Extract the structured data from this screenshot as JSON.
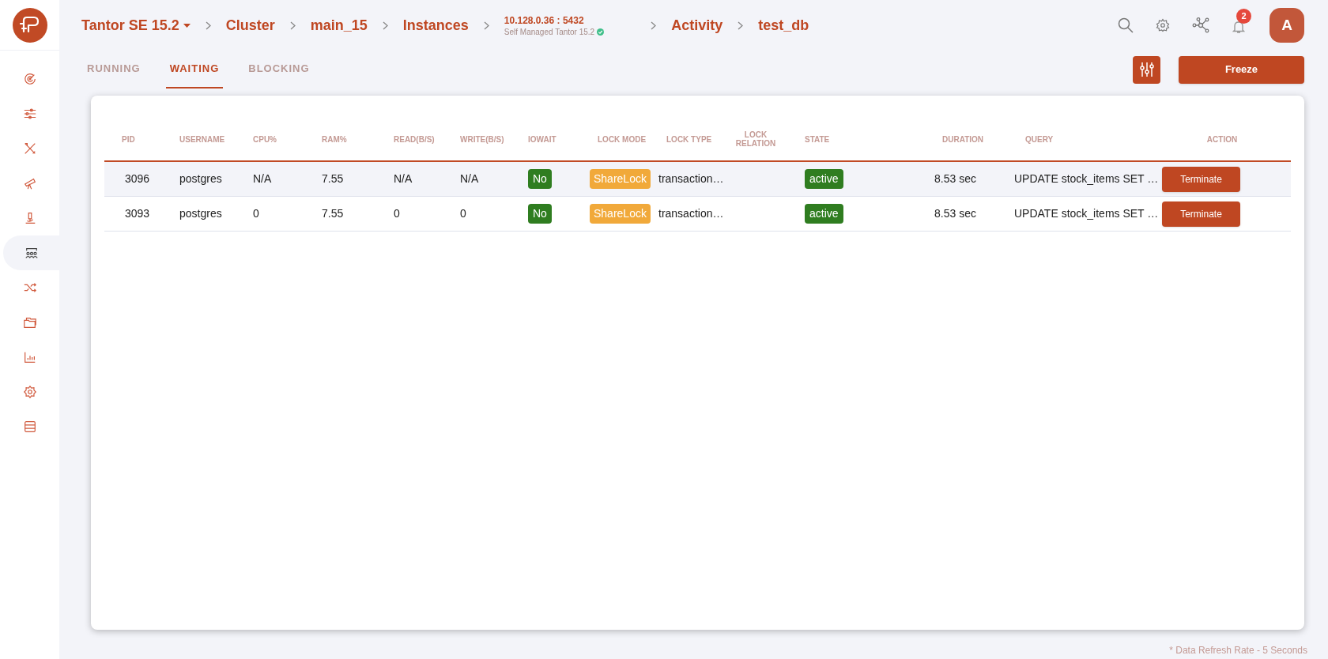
{
  "breadcrumb": [
    {
      "kind": "dropdown",
      "label": "Tantor SE 15.2"
    },
    {
      "kind": "link",
      "label": "Cluster"
    },
    {
      "kind": "link",
      "label": "main_15"
    },
    {
      "kind": "link",
      "label": "Instances"
    },
    {
      "kind": "host",
      "label": "10.128.0.36 : 5432",
      "subtitle": "Self Managed Tantor 15.2"
    },
    {
      "kind": "link",
      "label": "Activity"
    },
    {
      "kind": "link",
      "label": "test_db"
    }
  ],
  "notifications": {
    "count": "2"
  },
  "avatar": {
    "initial": "A"
  },
  "sidebar": {
    "items": [
      {
        "selected": false
      },
      {
        "selected": false
      },
      {
        "selected": false
      },
      {
        "selected": false
      },
      {
        "selected": false
      },
      {
        "selected": true
      },
      {
        "selected": false
      },
      {
        "selected": false
      },
      {
        "selected": false
      },
      {
        "selected": false
      },
      {
        "selected": false
      }
    ]
  },
  "tabs": [
    {
      "label": "RUNNING",
      "selected": false
    },
    {
      "label": "WAITING",
      "selected": true
    },
    {
      "label": "BLOCKING",
      "selected": false
    }
  ],
  "freeze_button": "Freeze",
  "table": {
    "columns": [
      "PID",
      "USERNAME",
      "CPU%",
      "RAM%",
      "READ(B/S)",
      "WRITE(B/S)",
      "IOWAIT",
      "LOCK MODE",
      "LOCK TYPE",
      "LOCK RELATION",
      "STATE",
      "DURATION",
      "QUERY",
      "ACTION"
    ],
    "rows": [
      {
        "selected": true,
        "pid": "3096",
        "username": "postgres",
        "cpu": "N/A",
        "ram": "7.55",
        "read": "N/A",
        "write": "N/A",
        "iowait": "No",
        "lock_mode": "ShareLock",
        "lock_type": "transaction…",
        "state": "active",
        "duration": "8.53 sec",
        "query": "UPDATE stock_items SET …",
        "action": "Terminate"
      },
      {
        "selected": false,
        "pid": "3093",
        "username": "postgres",
        "cpu": "0",
        "ram": "7.55",
        "read": "0",
        "write": "0",
        "iowait": "No",
        "lock_mode": "ShareLock",
        "lock_type": "transaction…",
        "state": "active",
        "duration": "8.53 sec",
        "query": "UPDATE stock_items SET …",
        "action": "Terminate"
      }
    ]
  },
  "footer_note": "* Data Refresh Rate - 5 Seconds"
}
